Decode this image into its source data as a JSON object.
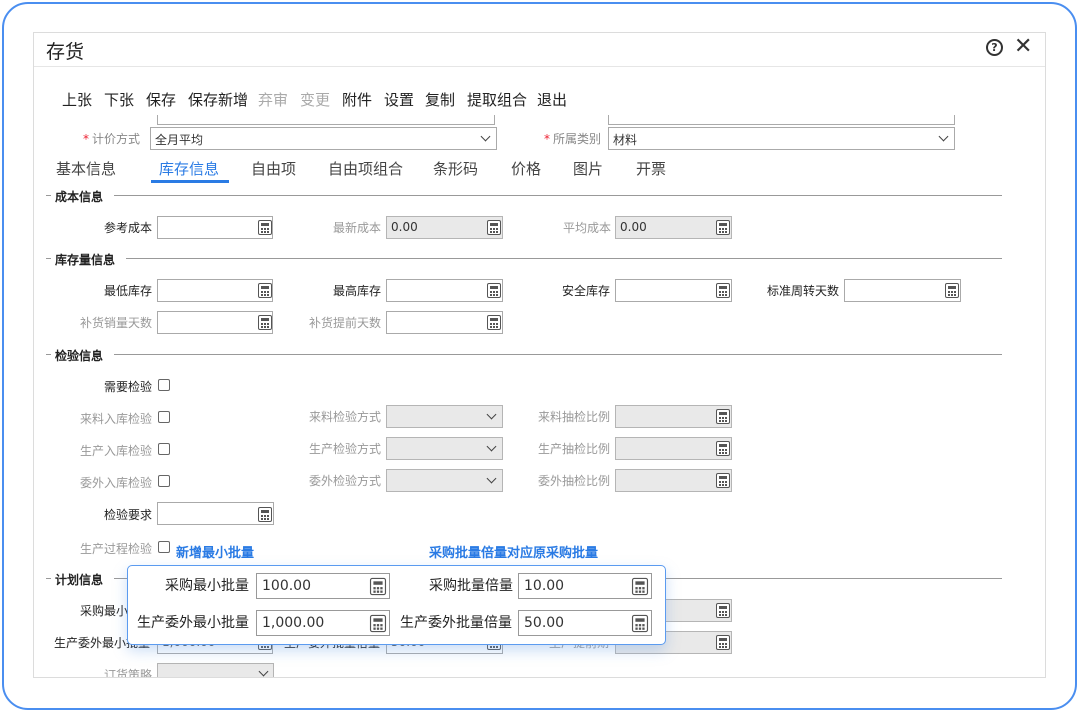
{
  "window": {
    "title": "存货"
  },
  "toolbar": {
    "buttons": [
      {
        "label": "上张",
        "disabled": false
      },
      {
        "label": "下张",
        "disabled": false
      },
      {
        "label": "保存",
        "disabled": false
      },
      {
        "label": "保存新增",
        "disabled": false
      },
      {
        "label": "弃审",
        "disabled": true
      },
      {
        "label": "变更",
        "disabled": true
      },
      {
        "label": "附件",
        "disabled": false
      },
      {
        "label": "设置",
        "disabled": false
      },
      {
        "label": "复制",
        "disabled": false
      },
      {
        "label": "提取组合",
        "disabled": false
      },
      {
        "label": "退出",
        "disabled": false
      }
    ]
  },
  "header_fields": {
    "pricing_method": {
      "label": "计价方式",
      "value": "全月平均"
    },
    "category": {
      "label": "所属类别",
      "value": "材料"
    }
  },
  "tabs": [
    "基本信息",
    "库存信息",
    "自由项",
    "自由项组合",
    "条形码",
    "价格",
    "图片",
    "开票"
  ],
  "active_tab": "库存信息",
  "cost_section": {
    "title": "成本信息",
    "reference_cost": {
      "label": "参考成本",
      "value": ""
    },
    "latest_cost": {
      "label": "最新成本",
      "value": "0.00"
    },
    "average_cost": {
      "label": "平均成本",
      "value": "0.00"
    }
  },
  "stock_section": {
    "title": "库存量信息",
    "min_stock": {
      "label": "最低库存",
      "value": ""
    },
    "max_stock": {
      "label": "最高库存",
      "value": ""
    },
    "safety_stock": {
      "label": "安全库存",
      "value": ""
    },
    "turnover_days": {
      "label": "标准周转天数",
      "value": ""
    },
    "replenish_sales_days": {
      "label": "补货销量天数",
      "value": ""
    },
    "replenish_lead_days": {
      "label": "补货提前天数",
      "value": ""
    }
  },
  "inspection_section": {
    "title": "检验信息",
    "need_inspection": "需要检验",
    "incoming_inspection": "来料入库检验",
    "production_inspection": "生产入库检验",
    "outsource_inspection": "委外入库检验",
    "incoming_method": "来料检验方式",
    "production_method": "生产检验方式",
    "outsource_method": "委外检验方式",
    "incoming_ratio": "来料抽检比例",
    "production_ratio": "生产抽检比例",
    "outsource_ratio": "委外抽检比例",
    "requirement": "检验要求",
    "process_inspection": "生产过程检验"
  },
  "plan_section": {
    "title": "计划信息",
    "purchase_min_partial": "采购最小",
    "production_outsource_min_partial": "生产委外最小批量",
    "under_value1": "1,000.00",
    "under_label2": "生产委外批量倍量",
    "under_value2": "50.00",
    "under_label3": "生产提前期",
    "order_strategy": "订货策略"
  },
  "callouts": {
    "new_min_batch": "新增最小批量",
    "purchase_multiple": "采购批量倍量对应原采购批量"
  },
  "overlay": {
    "purchase_min_batch": {
      "label": "采购最小批量",
      "value": "100.00"
    },
    "purchase_batch_multiple": {
      "label": "采购批量倍量",
      "value": "10.00"
    },
    "production_outsource_min_batch": {
      "label": "生产委外最小批量",
      "value": "1,000.00"
    },
    "production_outsource_batch_multiple": {
      "label": "生产委外批量倍量",
      "value": "50.00"
    }
  },
  "colors": {
    "accent": "#2a7be4",
    "frame": "#4a8ef0",
    "required": "#e23"
  }
}
